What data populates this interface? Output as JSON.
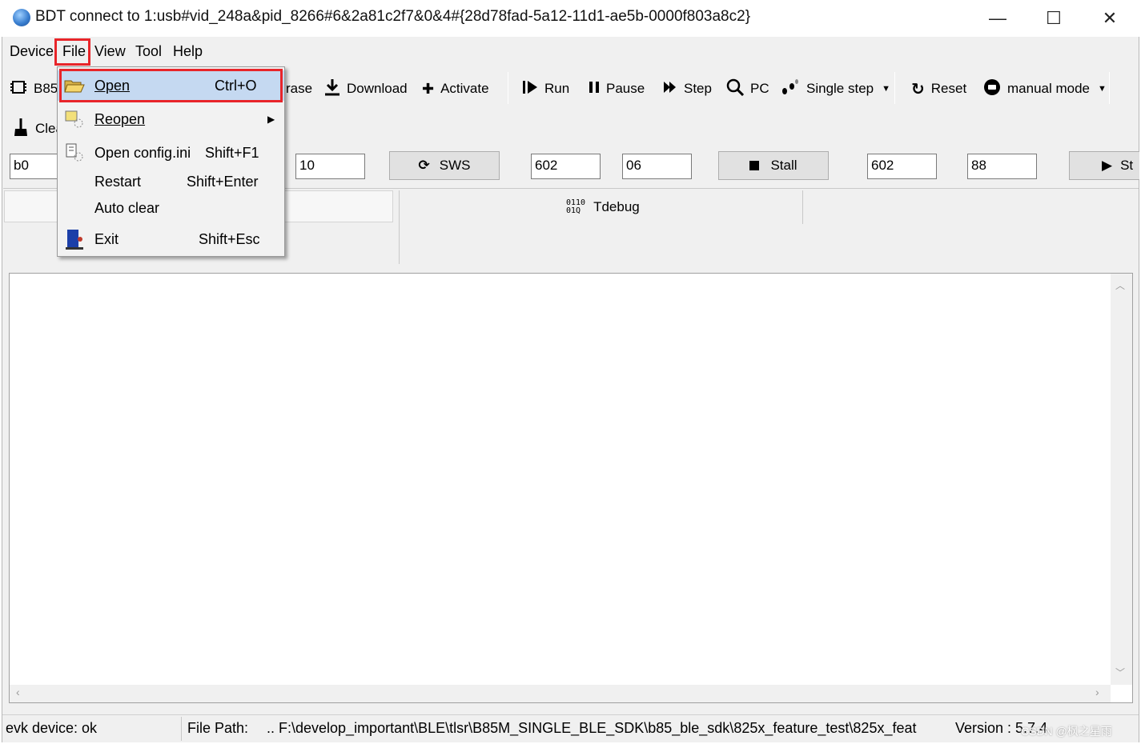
{
  "window": {
    "title": "BDT connect to 1:usb#vid_248a&pid_8266#6&2a81c2f7&0&4#{28d78fad-5a12-11d1-ae5b-0000f803a8c2}",
    "controls": {
      "minimize": "—",
      "maximize": "☐",
      "close": "✕"
    }
  },
  "menubar": {
    "device": "Device",
    "file": "File",
    "view": "View",
    "tool": "Tool",
    "help": "Help"
  },
  "toolbar": {
    "chip_partial": "B85",
    "erase_partial": "rase",
    "download": "Download",
    "activate": "Activate",
    "run": "Run",
    "pause": "Pause",
    "step": "Step",
    "pc": "PC",
    "single_step": "Single step",
    "reset": "Reset",
    "manual_mode": "manual mode",
    "clear_partial": "Clea"
  },
  "row2": {
    "field1": "b0",
    "field2": "10",
    "sws_button": "SWS",
    "field3": "602",
    "field4": "06",
    "stall_button": "Stall",
    "field5": "602",
    "field6": "88",
    "start_partial": "St"
  },
  "tabs": {
    "tdebug": "Tdebug"
  },
  "file_menu": {
    "open": {
      "label": "Open",
      "shortcut": "Ctrl+O"
    },
    "reopen": {
      "label": "Reopen"
    },
    "open_config": {
      "label": "Open config.ini",
      "shortcut": "Shift+F1"
    },
    "restart": {
      "label": "Restart",
      "shortcut": "Shift+Enter"
    },
    "auto_clear": {
      "label": "Auto clear"
    },
    "exit": {
      "label": "Exit",
      "shortcut": "Shift+Esc"
    }
  },
  "statusbar": {
    "device_status": "evk device: ok",
    "file_path_label": "File Path:",
    "file_path_value": "..  F:\\develop_important\\BLE\\tlsr\\B85M_SINGLE_BLE_SDK\\b85_ble_sdk\\825x_feature_test\\825x_feat",
    "version": "Version : 5.7.4",
    "watermark": "CSDN @枫之星雨"
  },
  "colors": {
    "highlight_red": "#e8252a",
    "menu_highlight": "#c5d9f1",
    "window_bg": "#f0f0f0"
  }
}
